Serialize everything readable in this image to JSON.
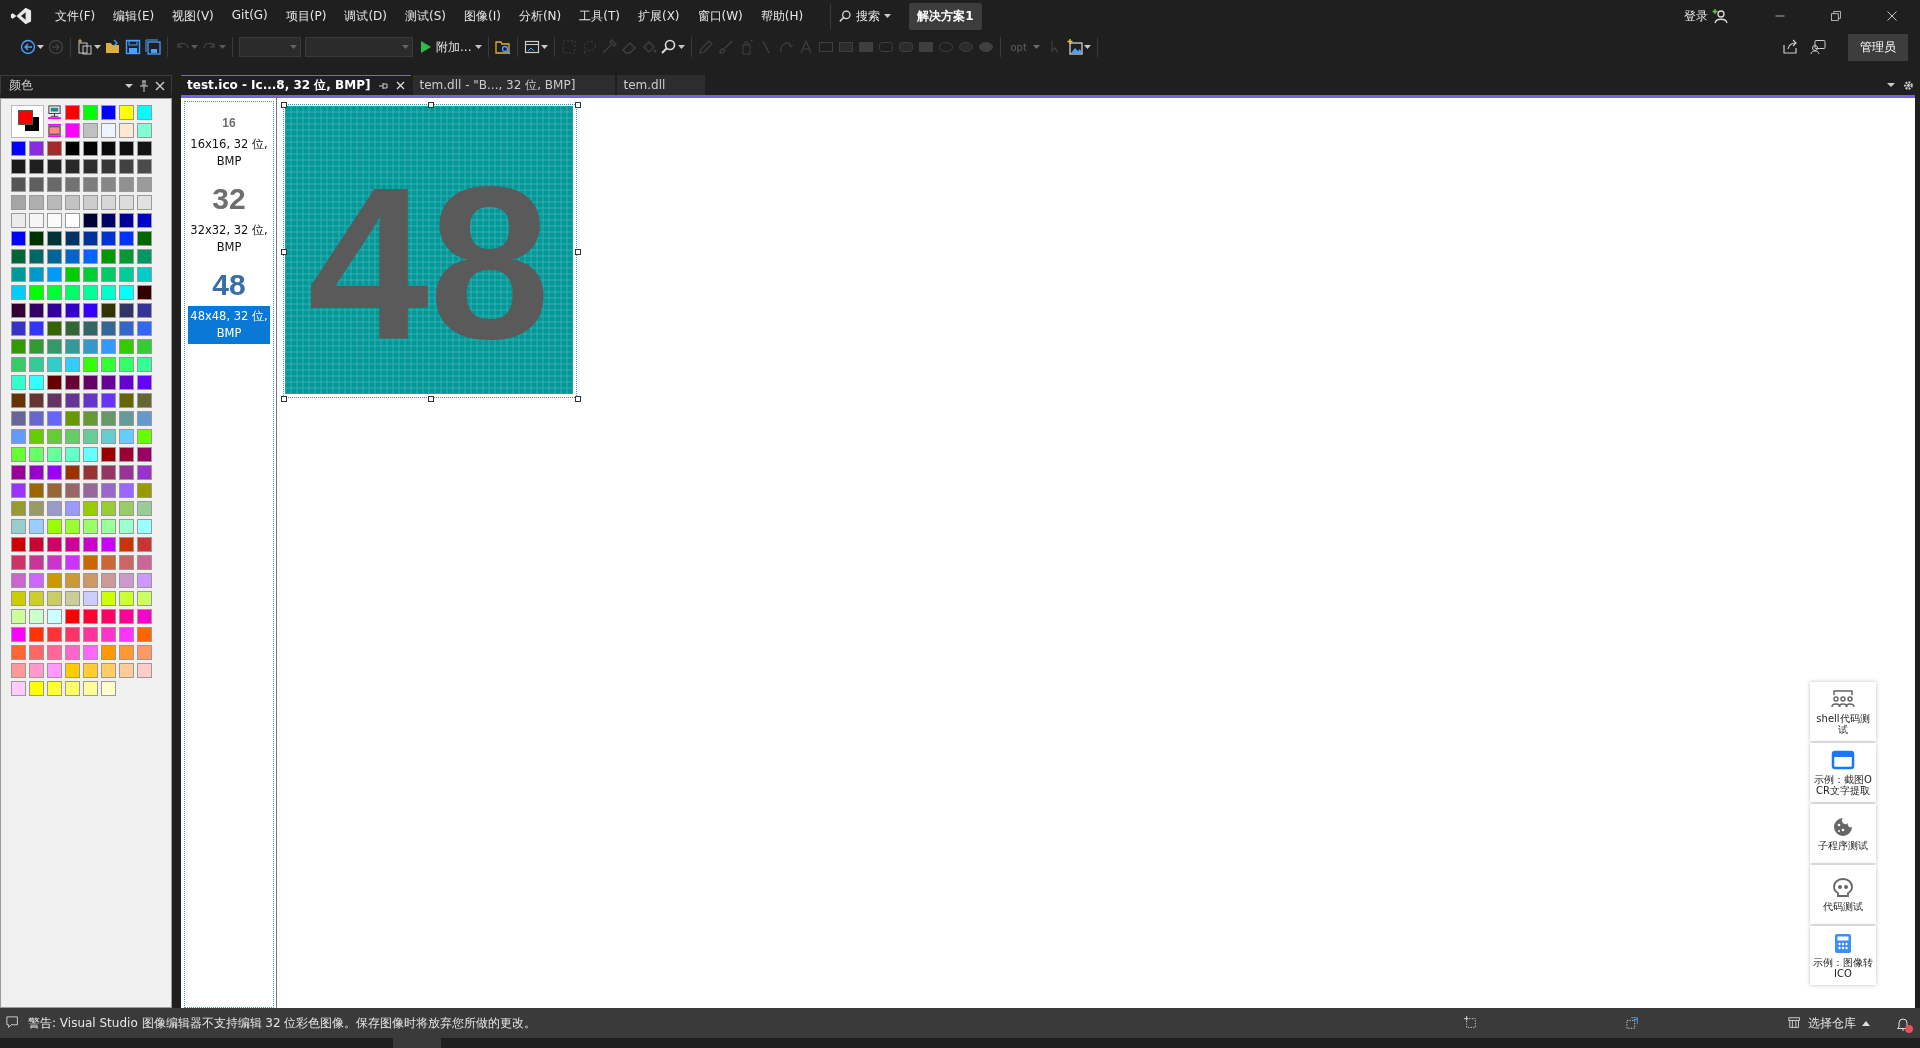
{
  "title_bar": {
    "menu": [
      "文件(F)",
      "编辑(E)",
      "视图(V)",
      "Git(G)",
      "项目(P)",
      "调试(D)",
      "测试(S)",
      "图像(I)",
      "分析(N)",
      "工具(T)",
      "扩展(X)",
      "窗口(W)",
      "帮助(H)"
    ],
    "search_label": "搜索",
    "solution": "解决方案1",
    "sign_in": "登录"
  },
  "toolbar": [
    {
      "items": [
        {
          "kind": "icon",
          "disabled": false,
          "dropdown": true
        },
        {
          "kind": "icon",
          "disabled": true,
          "dropdown": false
        }
      ]
    },
    {
      "items": [
        {
          "kind": "icon",
          "disabled": false,
          "dropdown": true
        },
        {
          "kind": "icon",
          "disabled": false,
          "dropdown": false
        },
        {
          "kind": "icon",
          "disabled": false,
          "dropdown": false
        },
        {
          "kind": "icon",
          "disabled": false,
          "dropdown": false
        }
      ]
    },
    {
      "items": [
        {
          "kind": "icon",
          "disabled": true,
          "dropdown": true
        },
        {
          "kind": "icon",
          "disabled": true,
          "dropdown": true
        }
      ]
    },
    {
      "items": [
        {
          "kind": "combo",
          "disabled": true,
          "dropdown": true
        },
        {
          "kind": "combo",
          "disabled": true,
          "dropdown": true
        },
        {
          "kind": "button",
          "label": "附加...",
          "disabled": false,
          "dropdown": true
        }
      ]
    },
    {
      "items": [
        {
          "kind": "icon",
          "disabled": false,
          "dropdown": false
        }
      ]
    },
    {
      "items": [
        {
          "kind": "icon",
          "disabled": false,
          "dropdown": true
        }
      ]
    },
    {
      "items": [
        {
          "kind": "icon",
          "disabled": true,
          "dropdown": false
        },
        {
          "kind": "icon",
          "disabled": true,
          "dropdown": false
        },
        {
          "kind": "icon",
          "disabled": true,
          "dropdown": false
        },
        {
          "kind": "icon",
          "disabled": true,
          "dropdown": false
        },
        {
          "kind": "icon",
          "disabled": true,
          "dropdown": false
        },
        {
          "kind": "icon",
          "disabled": false,
          "dropdown": true
        }
      ]
    },
    {
      "items": [
        {
          "kind": "icon",
          "disabled": true,
          "dropdown": false
        },
        {
          "kind": "icon",
          "disabled": true,
          "dropdown": false
        },
        {
          "kind": "icon",
          "disabled": true,
          "dropdown": false
        },
        {
          "kind": "icon",
          "disabled": true,
          "dropdown": false
        },
        {
          "kind": "icon",
          "disabled": true,
          "dropdown": false
        },
        {
          "kind": "icon",
          "disabled": true,
          "dropdown": false
        },
        {
          "kind": "icon",
          "disabled": true,
          "dropdown": false
        },
        {
          "kind": "icon",
          "disabled": true,
          "dropdown": false
        },
        {
          "kind": "icon",
          "disabled": true,
          "dropdown": false
        },
        {
          "kind": "icon",
          "disabled": true,
          "dropdown": false
        },
        {
          "kind": "icon",
          "disabled": true,
          "dropdown": false
        },
        {
          "kind": "icon",
          "disabled": true,
          "dropdown": false
        },
        {
          "kind": "icon",
          "disabled": true,
          "dropdown": false
        },
        {
          "kind": "icon",
          "disabled": true,
          "dropdown": false
        },
        {
          "kind": "icon",
          "disabled": true,
          "dropdown": false
        }
      ]
    },
    {
      "items": [
        {
          "kind": "combo",
          "label": "opt",
          "disabled": true,
          "dropdown": true
        },
        {
          "kind": "icon",
          "disabled": true,
          "dropdown": false
        },
        {
          "kind": "icon",
          "disabled": false,
          "dropdown": true
        }
      ]
    }
  ],
  "admin_label": "管理员",
  "colors_panel": {
    "title": "颜色",
    "current_colors": [
      {
        "color": "#ff0000"
      },
      {
        "color": "#000000"
      }
    ],
    "top_rows": [
      {
        "swatches": [
          {
            "color": "#ff0000"
          },
          {
            "color": "#00ff00"
          },
          {
            "color": "#0000ff"
          },
          {
            "color": "#ffff00"
          },
          {
            "color": "#00ffff"
          }
        ]
      },
      {
        "swatches": [
          {
            "color": "#ff00ff"
          },
          {
            "color": "#c0c0c0"
          },
          {
            "color": "#eef4ff"
          },
          {
            "color": "#fde9d3"
          },
          {
            "color": "#80ffd4"
          }
        ]
      }
    ],
    "rows": [
      {
        "swatches": [
          {
            "color": "#0000ff"
          },
          {
            "color": "#8a2be2"
          },
          {
            "color": "#a52a2a"
          },
          {
            "color": "#000000"
          },
          {
            "color": "#050505"
          },
          {
            "color": "#0a0a0a"
          },
          {
            "color": "#0f0f0f"
          },
          {
            "color": "#141414"
          }
        ]
      },
      {
        "swatches": [
          {
            "color": "#1a1a1a"
          },
          {
            "color": "#1e1e1e"
          },
          {
            "color": "#232323"
          },
          {
            "color": "#282828"
          },
          {
            "color": "#2d2d2d"
          },
          {
            "color": "#373737"
          },
          {
            "color": "#414141"
          },
          {
            "color": "#4b4b4b"
          }
        ]
      },
      {
        "swatches": [
          {
            "color": "#555555"
          },
          {
            "color": "#5f5f5f"
          },
          {
            "color": "#696969"
          },
          {
            "color": "#737373"
          },
          {
            "color": "#7d7d7d"
          },
          {
            "color": "#878787"
          },
          {
            "color": "#919191"
          },
          {
            "color": "#9b9b9b"
          }
        ]
      },
      {
        "swatches": [
          {
            "color": "#a5a5a5"
          },
          {
            "color": "#afafaf"
          },
          {
            "color": "#b9b9b9"
          },
          {
            "color": "#c3c3c3"
          },
          {
            "color": "#cdcdcd"
          },
          {
            "color": "#d7d7d7"
          },
          {
            "color": "#dcdcdc"
          },
          {
            "color": "#e1e1e1"
          }
        ]
      },
      {
        "swatches": [
          {
            "color": "#ebebeb"
          },
          {
            "color": "#f5f5f5"
          },
          {
            "color": "#fafafa"
          },
          {
            "color": "#ffffff"
          },
          {
            "color": "#000033"
          },
          {
            "color": "#000066"
          },
          {
            "color": "#000099"
          },
          {
            "color": "#0000cc"
          }
        ]
      },
      {
        "swatches": [
          {
            "color": "#0000ff"
          },
          {
            "color": "#003300"
          },
          {
            "color": "#003333"
          },
          {
            "color": "#003366"
          },
          {
            "color": "#003399"
          },
          {
            "color": "#0033cc"
          },
          {
            "color": "#0033ff"
          },
          {
            "color": "#006600"
          }
        ]
      },
      {
        "swatches": [
          {
            "color": "#006633"
          },
          {
            "color": "#006666"
          },
          {
            "color": "#006699"
          },
          {
            "color": "#0066cc"
          },
          {
            "color": "#0066ff"
          },
          {
            "color": "#009900"
          },
          {
            "color": "#009933"
          },
          {
            "color": "#009966"
          }
        ]
      },
      {
        "swatches": [
          {
            "color": "#009999"
          },
          {
            "color": "#0099cc"
          },
          {
            "color": "#0099ff"
          },
          {
            "color": "#00cc00"
          },
          {
            "color": "#00cc33"
          },
          {
            "color": "#00cc66"
          },
          {
            "color": "#00cc99"
          },
          {
            "color": "#00cccc"
          }
        ]
      },
      {
        "swatches": [
          {
            "color": "#00ccff"
          },
          {
            "color": "#00ff00"
          },
          {
            "color": "#00ff33"
          },
          {
            "color": "#00ff66"
          },
          {
            "color": "#00ff99"
          },
          {
            "color": "#00ffcc"
          },
          {
            "color": "#00ffff"
          },
          {
            "color": "#330000"
          }
        ]
      },
      {
        "swatches": [
          {
            "color": "#330033"
          },
          {
            "color": "#330066"
          },
          {
            "color": "#330099"
          },
          {
            "color": "#3300cc"
          },
          {
            "color": "#3300ff"
          },
          {
            "color": "#333300"
          },
          {
            "color": "#333366"
          },
          {
            "color": "#333399"
          }
        ]
      },
      {
        "swatches": [
          {
            "color": "#3333cc"
          },
          {
            "color": "#3333ff"
          },
          {
            "color": "#336600"
          },
          {
            "color": "#336633"
          },
          {
            "color": "#336666"
          },
          {
            "color": "#336699"
          },
          {
            "color": "#3366cc"
          },
          {
            "color": "#3366ff"
          }
        ]
      },
      {
        "swatches": [
          {
            "color": "#339900"
          },
          {
            "color": "#339933"
          },
          {
            "color": "#339966"
          },
          {
            "color": "#339999"
          },
          {
            "color": "#3399cc"
          },
          {
            "color": "#3399ff"
          },
          {
            "color": "#33cc00"
          },
          {
            "color": "#33cc33"
          }
        ]
      },
      {
        "swatches": [
          {
            "color": "#33cc66"
          },
          {
            "color": "#33cc99"
          },
          {
            "color": "#33cccc"
          },
          {
            "color": "#33ccff"
          },
          {
            "color": "#33ff00"
          },
          {
            "color": "#33ff33"
          },
          {
            "color": "#33ff66"
          },
          {
            "color": "#33ff99"
          }
        ]
      },
      {
        "swatches": [
          {
            "color": "#33ffcc"
          },
          {
            "color": "#33ffff"
          },
          {
            "color": "#660000"
          },
          {
            "color": "#660033"
          },
          {
            "color": "#660066"
          },
          {
            "color": "#660099"
          },
          {
            "color": "#6600cc"
          },
          {
            "color": "#6600ff"
          }
        ]
      },
      {
        "swatches": [
          {
            "color": "#663300"
          },
          {
            "color": "#663333"
          },
          {
            "color": "#663366"
          },
          {
            "color": "#663399"
          },
          {
            "color": "#6633cc"
          },
          {
            "color": "#6633ff"
          },
          {
            "color": "#666600"
          },
          {
            "color": "#666633"
          }
        ]
      },
      {
        "swatches": [
          {
            "color": "#666699"
          },
          {
            "color": "#6666cc"
          },
          {
            "color": "#6666ff"
          },
          {
            "color": "#669900"
          },
          {
            "color": "#669933"
          },
          {
            "color": "#669966"
          },
          {
            "color": "#669999"
          },
          {
            "color": "#6699cc"
          }
        ]
      },
      {
        "swatches": [
          {
            "color": "#6699ff"
          },
          {
            "color": "#66cc00"
          },
          {
            "color": "#66cc33"
          },
          {
            "color": "#66cc66"
          },
          {
            "color": "#66cc99"
          },
          {
            "color": "#66cccc"
          },
          {
            "color": "#66ccff"
          },
          {
            "color": "#66ff00"
          }
        ]
      },
      {
        "swatches": [
          {
            "color": "#66ff33"
          },
          {
            "color": "#66ff66"
          },
          {
            "color": "#66ff99"
          },
          {
            "color": "#66ffcc"
          },
          {
            "color": "#66ffff"
          },
          {
            "color": "#990000"
          },
          {
            "color": "#990033"
          },
          {
            "color": "#990066"
          }
        ]
      },
      {
        "swatches": [
          {
            "color": "#990099"
          },
          {
            "color": "#9900cc"
          },
          {
            "color": "#9900ff"
          },
          {
            "color": "#993300"
          },
          {
            "color": "#993333"
          },
          {
            "color": "#993366"
          },
          {
            "color": "#993399"
          },
          {
            "color": "#9933cc"
          }
        ]
      },
      {
        "swatches": [
          {
            "color": "#9933ff"
          },
          {
            "color": "#996600"
          },
          {
            "color": "#996633"
          },
          {
            "color": "#996666"
          },
          {
            "color": "#996699"
          },
          {
            "color": "#9966cc"
          },
          {
            "color": "#9966ff"
          },
          {
            "color": "#999900"
          }
        ]
      },
      {
        "swatches": [
          {
            "color": "#999933"
          },
          {
            "color": "#999966"
          },
          {
            "color": "#9999cc"
          },
          {
            "color": "#9999ff"
          },
          {
            "color": "#99cc00"
          },
          {
            "color": "#99cc33"
          },
          {
            "color": "#99cc66"
          },
          {
            "color": "#99cc99"
          }
        ]
      },
      {
        "swatches": [
          {
            "color": "#99cccc"
          },
          {
            "color": "#99ccff"
          },
          {
            "color": "#99ff00"
          },
          {
            "color": "#99ff33"
          },
          {
            "color": "#99ff66"
          },
          {
            "color": "#99ff99"
          },
          {
            "color": "#99ffcc"
          },
          {
            "color": "#99ffff"
          }
        ]
      },
      {
        "swatches": [
          {
            "color": "#cc0000"
          },
          {
            "color": "#cc0033"
          },
          {
            "color": "#cc0066"
          },
          {
            "color": "#cc0099"
          },
          {
            "color": "#cc00cc"
          },
          {
            "color": "#cc00ff"
          },
          {
            "color": "#cc3300"
          },
          {
            "color": "#cc3333"
          }
        ]
      },
      {
        "swatches": [
          {
            "color": "#cc3366"
          },
          {
            "color": "#cc3399"
          },
          {
            "color": "#cc33cc"
          },
          {
            "color": "#cc33ff"
          },
          {
            "color": "#cc6600"
          },
          {
            "color": "#cc6633"
          },
          {
            "color": "#cc6666"
          },
          {
            "color": "#cc6699"
          }
        ]
      },
      {
        "swatches": [
          {
            "color": "#cc66cc"
          },
          {
            "color": "#cc66ff"
          },
          {
            "color": "#cc9900"
          },
          {
            "color": "#cc9933"
          },
          {
            "color": "#cc9966"
          },
          {
            "color": "#cc9999"
          },
          {
            "color": "#cc99cc"
          },
          {
            "color": "#cc99ff"
          }
        ]
      },
      {
        "swatches": [
          {
            "color": "#cccc00"
          },
          {
            "color": "#cccc33"
          },
          {
            "color": "#cccc66"
          },
          {
            "color": "#cccc99"
          },
          {
            "color": "#ccccff"
          },
          {
            "color": "#ccff00"
          },
          {
            "color": "#ccff33"
          },
          {
            "color": "#ccff66"
          }
        ]
      },
      {
        "swatches": [
          {
            "color": "#ccff99"
          },
          {
            "color": "#ccffcc"
          },
          {
            "color": "#ccffff"
          },
          {
            "color": "#ff0000"
          },
          {
            "color": "#ff0033"
          },
          {
            "color": "#ff0066"
          },
          {
            "color": "#ff0099"
          },
          {
            "color": "#ff00cc"
          }
        ]
      },
      {
        "swatches": [
          {
            "color": "#ff00ff"
          },
          {
            "color": "#ff3300"
          },
          {
            "color": "#ff3333"
          },
          {
            "color": "#ff3366"
          },
          {
            "color": "#ff3399"
          },
          {
            "color": "#ff33cc"
          },
          {
            "color": "#ff33ff"
          },
          {
            "color": "#ff6600"
          }
        ]
      },
      {
        "swatches": [
          {
            "color": "#ff6633"
          },
          {
            "color": "#ff6666"
          },
          {
            "color": "#ff6699"
          },
          {
            "color": "#ff66cc"
          },
          {
            "color": "#ff66ff"
          },
          {
            "color": "#ff9900"
          },
          {
            "color": "#ff9933"
          },
          {
            "color": "#ff9966"
          }
        ]
      },
      {
        "swatches": [
          {
            "color": "#ff9999"
          },
          {
            "color": "#ff99cc"
          },
          {
            "color": "#ff99ff"
          },
          {
            "color": "#ffcc00"
          },
          {
            "color": "#ffcc33"
          },
          {
            "color": "#ffcc66"
          },
          {
            "color": "#ffcc99"
          },
          {
            "color": "#ffcccc"
          }
        ]
      },
      {
        "swatches": [
          {
            "color": "#ffccff"
          },
          {
            "color": "#ffff00"
          },
          {
            "color": "#ffff33"
          },
          {
            "color": "#ffff66"
          },
          {
            "color": "#ffff99"
          },
          {
            "color": "#ffffcc"
          }
        ]
      }
    ]
  },
  "tabs": [
    {
      "label": "test.ico - Ic...8, 32 位, BMP]",
      "selected": true
    },
    {
      "label": "tem.dll - \"B..., 32 位, BMP]",
      "selected": false
    },
    {
      "label": "tem.dll",
      "selected": false
    }
  ],
  "thumbnails": [
    {
      "preview": "16",
      "caption": "16x16, 32 位, BMP",
      "color": "#6e6e6e",
      "kind": "small",
      "selected": false
    },
    {
      "preview": "32",
      "caption": "32x32, 32 位, BMP",
      "color": "#6e6e6e",
      "kind": "large",
      "selected": false
    },
    {
      "preview": "48",
      "caption": "48x48, 32 位, BMP",
      "color": "#3b6ea5",
      "kind": "large",
      "selected": true
    }
  ],
  "canvas": {
    "image_text": "48"
  },
  "side_tools": [
    {
      "label": "shell代码测试"
    },
    {
      "label": "示例：截图OCR文字提取"
    },
    {
      "label": "子程序测试"
    },
    {
      "label": "代码测试"
    },
    {
      "label": "示例：图像转ICO"
    }
  ],
  "status_bar": {
    "message": "警告: Visual Studio 图像编辑器不支持编辑 32 位彩色图像。保存图像时将放弃您所做的更改。",
    "repo": "选择仓库"
  }
}
